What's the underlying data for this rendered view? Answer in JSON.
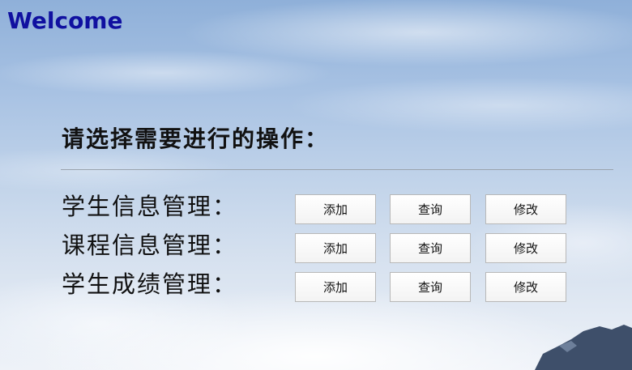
{
  "header": {
    "title": "Welcome"
  },
  "main": {
    "prompt": "请选择需要进行的操作：",
    "rows": [
      {
        "label": "学生信息管理：",
        "buttons": [
          "添加",
          "查询",
          "修改"
        ]
      },
      {
        "label": "课程信息管理：",
        "buttons": [
          "添加",
          "查询",
          "修改"
        ]
      },
      {
        "label": "学生成绩管理：",
        "buttons": [
          "添加",
          "查询",
          "修改"
        ]
      }
    ]
  },
  "colors": {
    "title": "#1010a0",
    "text": "#111111",
    "divider": "#9aa3ad",
    "button_border": "#b8b8b8"
  }
}
